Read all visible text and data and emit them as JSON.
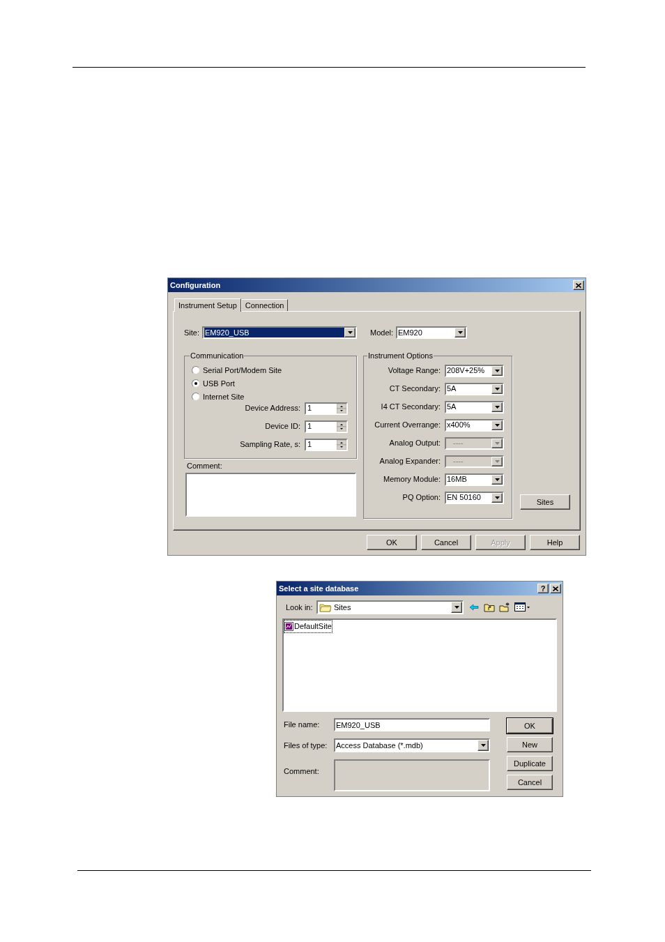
{
  "configuration_dialog": {
    "title": "Configuration",
    "tabs": [
      {
        "label": "Instrument Setup",
        "selected": true
      },
      {
        "label": "Connection",
        "selected": false
      }
    ],
    "site": {
      "label": "Site:",
      "value": "EM920_USB"
    },
    "model": {
      "label": "Model:",
      "value": "EM920"
    },
    "communication": {
      "title": "Communication",
      "options": [
        {
          "label": "Serial Port/Modem Site",
          "selected": false
        },
        {
          "label": "USB Port",
          "selected": true
        },
        {
          "label": "Internet Site",
          "selected": false
        }
      ],
      "fields": [
        {
          "label": "Device Address:",
          "value": "1"
        },
        {
          "label": "Device ID:",
          "value": "1"
        },
        {
          "label": "Sampling Rate, s:",
          "value": "1"
        }
      ]
    },
    "comment": {
      "label": "Comment:"
    },
    "instrument_options": {
      "title": "Instrument Options",
      "fields": [
        {
          "label": "Voltage Range:",
          "value": "208V+25%",
          "disabled": false
        },
        {
          "label": "CT Secondary:",
          "value": "5A",
          "disabled": false
        },
        {
          "label": "I4 CT Secondary:",
          "value": "5A",
          "disabled": false
        },
        {
          "label": "Current Overrange:",
          "value": "x400%",
          "disabled": false
        },
        {
          "label": "Analog Output:",
          "value": "----",
          "disabled": true
        },
        {
          "label": "Analog Expander:",
          "value": "----",
          "disabled": true
        },
        {
          "label": "Memory Module:",
          "value": "16MB",
          "disabled": false
        },
        {
          "label": "PQ Option:",
          "value": "EN 50160",
          "disabled": false
        }
      ]
    },
    "sites_button": "Sites",
    "buttons": [
      {
        "label": "OK",
        "disabled": false
      },
      {
        "label": "Cancel",
        "disabled": false
      },
      {
        "label": "Apply",
        "disabled": true
      },
      {
        "label": "Help",
        "disabled": false
      }
    ]
  },
  "site_database_dialog": {
    "title": "Select a site database",
    "help_button": "?",
    "look_in": {
      "label": "Look in:",
      "value": "Sites"
    },
    "files": [
      {
        "name": "DefaultSite",
        "selected": true
      }
    ],
    "file_name": {
      "label": "File name:",
      "value": "EM920_USB"
    },
    "files_of_type": {
      "label": "Files of type:",
      "value": "Access Database (*.mdb)"
    },
    "comment": {
      "label": "Comment:"
    },
    "buttons": [
      {
        "label": "OK",
        "default": true
      },
      {
        "label": "New",
        "default": false
      },
      {
        "label": "Duplicate",
        "default": false
      },
      {
        "label": "Cancel",
        "default": false
      }
    ]
  }
}
